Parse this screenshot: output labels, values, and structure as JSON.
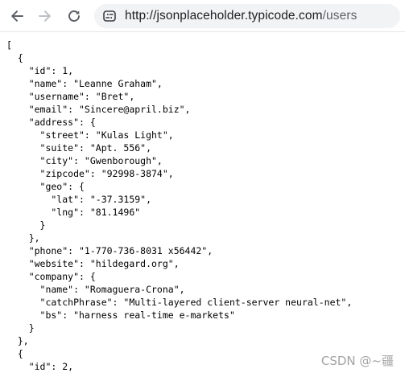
{
  "browser": {
    "url_host": "http://jsonplaceholder.typicode.com",
    "url_path": "/users",
    "icons": {
      "back": "arrow-left-icon",
      "forward": "arrow-right-icon",
      "reload": "reload-icon",
      "site_info": "site-info-icon"
    },
    "colors": {
      "toolbar_bg": "#ffffff",
      "address_bg": "#f1f3f4",
      "icon_active": "#5f6368",
      "icon_disabled": "#bdc1c6"
    }
  },
  "json_lines": [
    "[",
    "  {",
    "    \"id\": 1,",
    "    \"name\": \"Leanne Graham\",",
    "    \"username\": \"Bret\",",
    "    \"email\": \"Sincere@april.biz\",",
    "    \"address\": {",
    "      \"street\": \"Kulas Light\",",
    "      \"suite\": \"Apt. 556\",",
    "      \"city\": \"Gwenborough\",",
    "      \"zipcode\": \"92998-3874\",",
    "      \"geo\": {",
    "        \"lat\": \"-37.3159\",",
    "        \"lng\": \"81.1496\"",
    "      }",
    "    },",
    "    \"phone\": \"1-770-736-8031 x56442\",",
    "    \"website\": \"hildegard.org\",",
    "    \"company\": {",
    "      \"name\": \"Romaguera-Crona\",",
    "      \"catchPhrase\": \"Multi-layered client-server neural-net\",",
    "      \"bs\": \"harness real-time e-markets\"",
    "    }",
    "  },",
    "  {",
    "    \"id\": 2,"
  ],
  "watermark": "CSDN @~疆"
}
